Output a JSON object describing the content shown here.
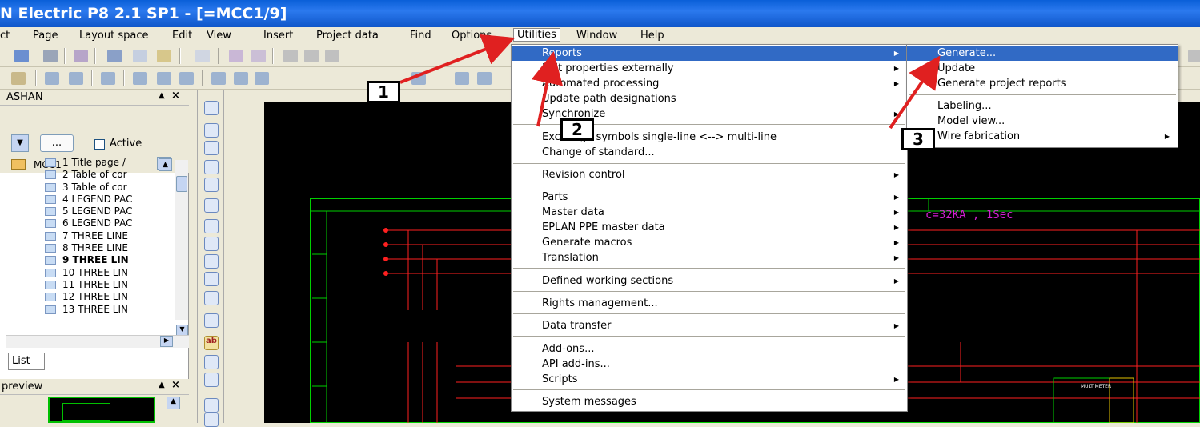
{
  "window": {
    "title": "N Electric P8 2.1 SP1 - [=MCC1/9]"
  },
  "menubar": {
    "items": [
      "ct",
      "Page",
      "Layout space",
      "Edit",
      "View",
      "Insert",
      "Project data",
      "Find",
      "Options",
      "Utilities",
      "Window",
      "Help"
    ]
  },
  "navigator": {
    "title": "ASHAN",
    "filter_button": "...",
    "active_label": "Active",
    "root": "MCC1",
    "pages": [
      "1 Title page /",
      "2 Table of cor",
      "3 Table of cor",
      "4 LEGEND PAC",
      "5 LEGEND PAC",
      "6 LEGEND PAC",
      "7 THREE LINE",
      "8 THREE LINE",
      "9 THREE LIN",
      "10 THREE LIN",
      "11 THREE LIN",
      "12 THREE LIN",
      "13 THREE LIN"
    ],
    "list_tab": "List",
    "preview_title": "preview"
  },
  "utilities_menu": {
    "items": [
      {
        "label": "Reports",
        "submenu": true
      },
      {
        "label": "Edit properties externally",
        "submenu": true
      },
      {
        "label": "Automated processing",
        "submenu": true
      },
      {
        "label": "Update path designations",
        "submenu": false
      },
      {
        "label": "Synchronize",
        "submenu": true
      },
      {
        "label": "Exchange symbols single-line <--> multi-line",
        "submenu": false
      },
      {
        "label": "Change of standard...",
        "submenu": false
      },
      {
        "label": "Revision control",
        "submenu": true
      },
      {
        "label": "Parts",
        "submenu": true
      },
      {
        "label": "Master data",
        "submenu": true
      },
      {
        "label": "EPLAN PPE master data",
        "submenu": true
      },
      {
        "label": "Generate macros",
        "submenu": true
      },
      {
        "label": "Translation",
        "submenu": true
      },
      {
        "label": "Defined working sections",
        "submenu": true
      },
      {
        "label": "Rights management...",
        "submenu": false
      },
      {
        "label": "Data transfer",
        "submenu": true
      },
      {
        "label": "Add-ons...",
        "submenu": false
      },
      {
        "label": "API add-ins...",
        "submenu": false
      },
      {
        "label": "Scripts",
        "submenu": true
      },
      {
        "label": "System messages",
        "submenu": false
      }
    ]
  },
  "reports_menu": {
    "items": [
      {
        "label": "Generate...",
        "submenu": false
      },
      {
        "label": "Update",
        "submenu": false
      },
      {
        "label": "Generate project reports",
        "submenu": false
      },
      {
        "label": "Labeling...",
        "submenu": false
      },
      {
        "label": "Model view...",
        "submenu": false
      },
      {
        "label": "Wire fabrication",
        "submenu": true
      }
    ]
  },
  "callouts": [
    "1",
    "2",
    "3"
  ],
  "schematic": {
    "annotation": "c=32KA , 1Sec",
    "multimeter_label": "MULTIMETER"
  },
  "colors": {
    "title_bar": "#0a5fd8",
    "highlight": "#316ac5",
    "schematic_bg": "#000000",
    "wire_red": "#ff2020",
    "frame_green": "#00d000",
    "annotation_magenta": "#d020d0"
  }
}
